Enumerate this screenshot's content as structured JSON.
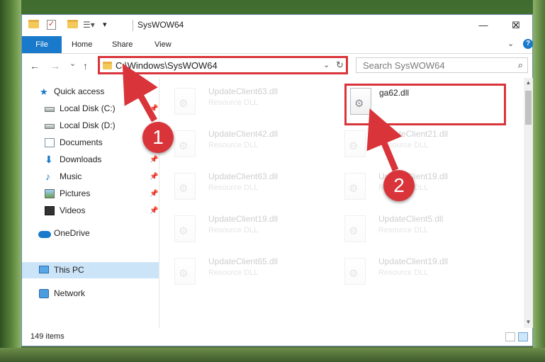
{
  "window": {
    "title": "SysWOW64",
    "controls": {
      "minimize": "—",
      "maximize": "☐",
      "close": "✕"
    }
  },
  "ribbon": {
    "tabs": [
      "File",
      "Home",
      "Share",
      "View"
    ]
  },
  "navigation": {
    "back": "←",
    "forward": "→",
    "recent": "⌄",
    "up": "↑",
    "address": "C:\\Windows\\SysWOW64",
    "refresh": "↻",
    "search_placeholder": "Search SysWOW64"
  },
  "sidebar": {
    "items": [
      {
        "label": "Quick access",
        "icon": "star-icon"
      },
      {
        "label": "Local Disk (C:)",
        "icon": "drive-icon",
        "pinned": true
      },
      {
        "label": "Local Disk (D:)",
        "icon": "drive-icon"
      },
      {
        "label": "Documents",
        "icon": "documents-icon"
      },
      {
        "label": "Downloads",
        "icon": "downloads-icon",
        "pinned": true
      },
      {
        "label": "Music",
        "icon": "music-icon",
        "pinned": true
      },
      {
        "label": "Pictures",
        "icon": "pictures-icon",
        "pinned": true
      },
      {
        "label": "Videos",
        "icon": "videos-icon",
        "pinned": true
      },
      {
        "label": "OneDrive",
        "icon": "onedrive-icon"
      },
      {
        "label": "This PC",
        "icon": "this-pc-icon",
        "selected": true
      },
      {
        "label": "Network",
        "icon": "network-icon"
      }
    ]
  },
  "files": [
    {
      "name": "UpdateClient63.dll",
      "type": "Resource DLL"
    },
    {
      "name": "ga62.dll",
      "type": "",
      "highlighted": true
    },
    {
      "name": "UpdateClient42.dll",
      "type": "Resource DLL"
    },
    {
      "name": "UpdateClient21.dll",
      "type": "Resource DLL"
    },
    {
      "name": "UpdateClient63.dll",
      "type": "Resource DLL"
    },
    {
      "name": "UpdateClient19.dll",
      "type": "Resource DLL"
    },
    {
      "name": "UpdateClient19.dll",
      "type": "Resource DLL"
    },
    {
      "name": "UpdateClient5.dll",
      "type": "Resource DLL"
    },
    {
      "name": "UpdateClient65.dll",
      "type": "Resource DLL"
    },
    {
      "name": "UpdateClient19.dll",
      "type": "Resource DLL"
    }
  ],
  "status": {
    "item_count": "149 items"
  },
  "annotations": {
    "step1": "1",
    "step2": "2",
    "color": "#d9343a"
  }
}
